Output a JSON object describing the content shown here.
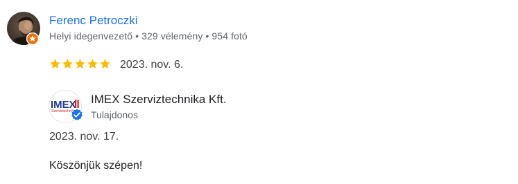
{
  "review": {
    "reviewer": {
      "name": "Ferenc Petroczki",
      "meta": "Helyi idegenvezető • 329 vélemény • 954 fotó",
      "avatar_icon": "user-photo-avatar",
      "badge_icon": "local-guide-badge-icon"
    },
    "rating": {
      "stars": 5,
      "max": 5,
      "star_color": "#fbbc04"
    },
    "date": "2023. nov. 6."
  },
  "owner_response": {
    "owner_name": "IMEX Szerviztechnika Kft.",
    "role": "Tulajdonos",
    "logo": {
      "brand_text": "IMEX",
      "sub_text": "Szerviztechnika",
      "brand_color": "#1f3a93",
      "accent_color": "#d42027"
    },
    "verified_icon": "verified-check-icon",
    "date": "2023. nov. 17.",
    "text": "Köszönjük szépen!"
  },
  "colors": {
    "link_blue": "#1a73e8",
    "secondary_text": "#5f6368",
    "verified_blue": "#1a73e8",
    "badge_orange": "#e8710a"
  }
}
